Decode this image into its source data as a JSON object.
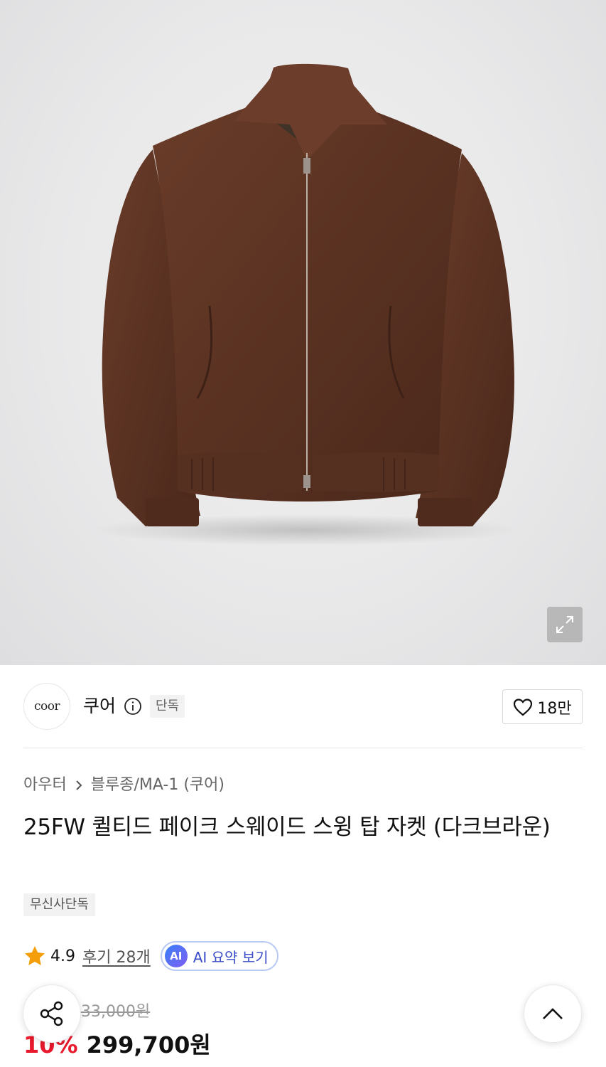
{
  "product_image": {
    "alt": "dark brown suede swing top jacket"
  },
  "brand": {
    "logo_text": "coor",
    "name": "쿠어",
    "exclusive_tag": "단독",
    "likes": "18만"
  },
  "breadcrumb": {
    "category": "아우터",
    "subcategory": "블루종/MA-1 (쿠어)"
  },
  "product": {
    "title": "25FW 퀼티드 페이크 스웨이드 스윙 탑 자켓 (다크브라운)",
    "store_tag": "무신사단독"
  },
  "rating": {
    "score": "4.9",
    "reviews": "후기 28개",
    "ai_badge": "AI",
    "ai_summary_label": "AI 요약 보기"
  },
  "price": {
    "original": "333,000원",
    "discount": "10%",
    "sale": "299,700원"
  },
  "icons": {
    "expand": "expand-icon",
    "info": "info-icon",
    "heart": "heart-icon",
    "chevron": "chevron-right-icon",
    "star": "star-icon",
    "share": "share-icon",
    "scroll_top": "chevron-up-icon"
  },
  "colors": {
    "star": "#f59e0b",
    "discount": "#e8192c",
    "ai_accent": "#3a4cc8",
    "jacket": "#5a3222"
  }
}
